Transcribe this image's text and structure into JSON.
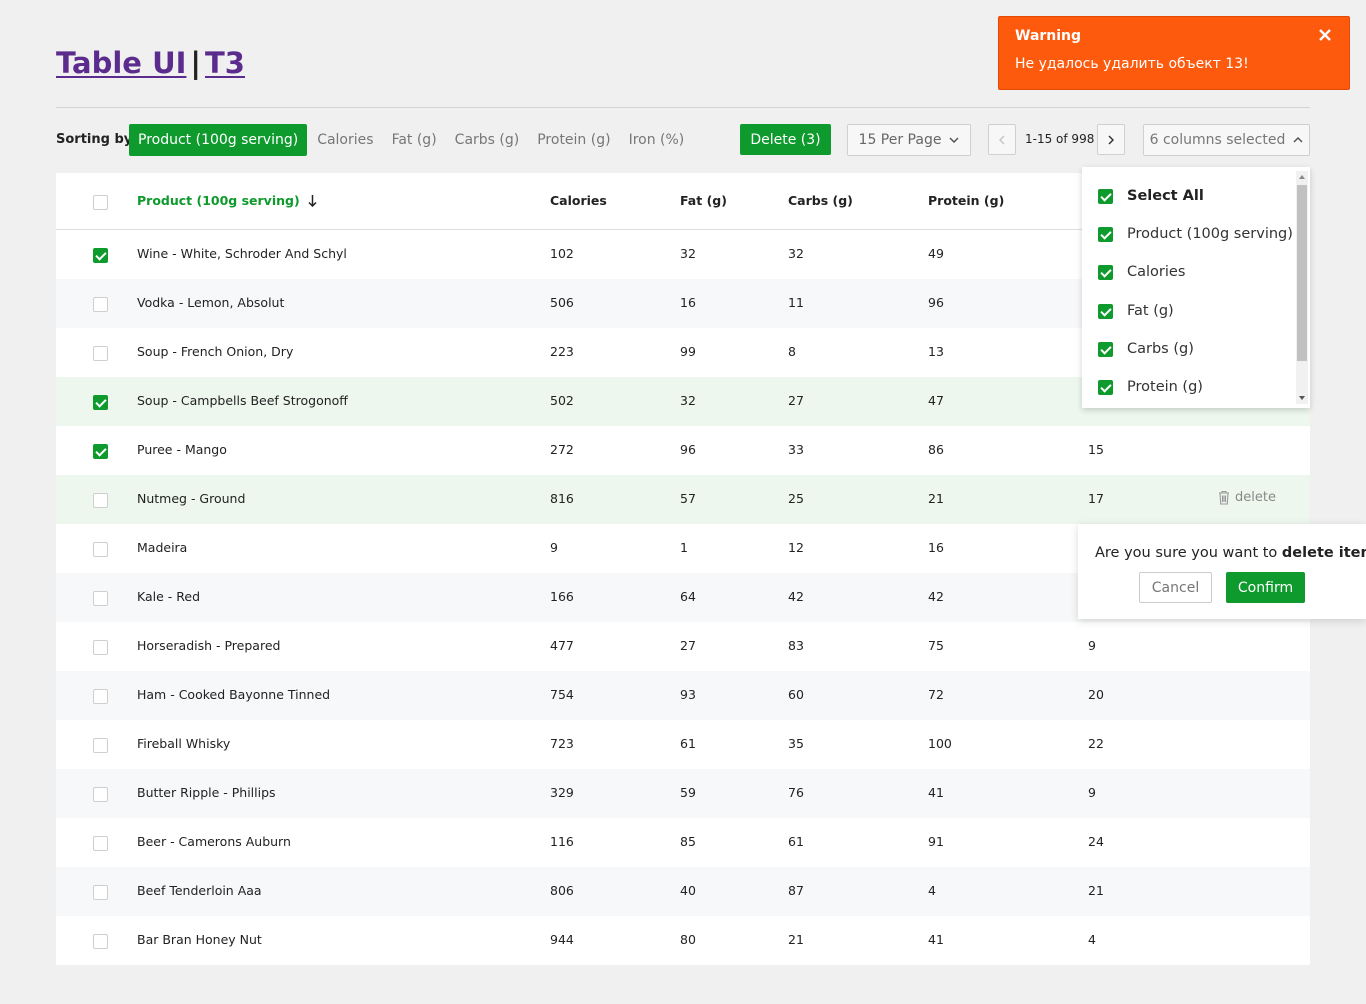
{
  "header": {
    "title_part1": "Table UI",
    "separator": "|",
    "title_part2": "T3"
  },
  "toolbar": {
    "sort_label": "Sorting by:",
    "sort_options": [
      "Product (100g serving)",
      "Calories",
      "Fat (g)",
      "Carbs (g)",
      "Protein (g)",
      "Iron (%)"
    ],
    "active_sort": "Product (100g serving)",
    "delete_label": "Delete (3)",
    "per_page_label": "15 Per Page",
    "pagination": "1-15 of 998",
    "columns_label": "6 columns selected"
  },
  "table": {
    "headers": [
      "Product (100g serving)",
      "Calories",
      "Fat (g)",
      "Carbs (g)",
      "Protein (g)"
    ],
    "rows": [
      {
        "checked": true,
        "highlight": false,
        "product": "Wine - White, Schroder And Schyl",
        "calories": "102",
        "fat": "32",
        "carbs": "32",
        "protein": "49",
        "iron": ""
      },
      {
        "checked": false,
        "highlight": false,
        "product": "Vodka - Lemon, Absolut",
        "calories": "506",
        "fat": "16",
        "carbs": "11",
        "protein": "96",
        "iron": ""
      },
      {
        "checked": false,
        "highlight": false,
        "product": "Soup - French Onion, Dry",
        "calories": "223",
        "fat": "99",
        "carbs": "8",
        "protein": "13",
        "iron": ""
      },
      {
        "checked": true,
        "highlight": true,
        "product": "Soup - Campbells Beef Strogonoff",
        "calories": "502",
        "fat": "32",
        "carbs": "27",
        "protein": "47",
        "iron": ""
      },
      {
        "checked": true,
        "highlight": false,
        "product": "Puree - Mango",
        "calories": "272",
        "fat": "96",
        "carbs": "33",
        "protein": "86",
        "iron": "15"
      },
      {
        "checked": false,
        "highlight": true,
        "product": "Nutmeg - Ground",
        "calories": "816",
        "fat": "57",
        "carbs": "25",
        "protein": "21",
        "iron": "17",
        "show_delete": true
      },
      {
        "checked": false,
        "highlight": false,
        "product": "Madeira",
        "calories": "9",
        "fat": "1",
        "carbs": "12",
        "protein": "16",
        "iron": ""
      },
      {
        "checked": false,
        "highlight": false,
        "product": "Kale - Red",
        "calories": "166",
        "fat": "64",
        "carbs": "42",
        "protein": "42",
        "iron": ""
      },
      {
        "checked": false,
        "highlight": false,
        "product": "Horseradish - Prepared",
        "calories": "477",
        "fat": "27",
        "carbs": "83",
        "protein": "75",
        "iron": "9"
      },
      {
        "checked": false,
        "highlight": false,
        "product": "Ham - Cooked Bayonne Tinned",
        "calories": "754",
        "fat": "93",
        "carbs": "60",
        "protein": "72",
        "iron": "20"
      },
      {
        "checked": false,
        "highlight": false,
        "product": "Fireball Whisky",
        "calories": "723",
        "fat": "61",
        "carbs": "35",
        "protein": "100",
        "iron": "22"
      },
      {
        "checked": false,
        "highlight": false,
        "product": "Butter Ripple - Phillips",
        "calories": "329",
        "fat": "59",
        "carbs": "76",
        "protein": "41",
        "iron": "9"
      },
      {
        "checked": false,
        "highlight": false,
        "product": "Beer - Camerons Auburn",
        "calories": "116",
        "fat": "85",
        "carbs": "61",
        "protein": "91",
        "iron": "24"
      },
      {
        "checked": false,
        "highlight": false,
        "product": "Beef Tenderloin Aaa",
        "calories": "806",
        "fat": "40",
        "carbs": "87",
        "protein": "4",
        "iron": "21"
      },
      {
        "checked": false,
        "highlight": false,
        "product": "Bar Bran Honey Nut",
        "calories": "944",
        "fat": "80",
        "carbs": "21",
        "protein": "41",
        "iron": "4"
      }
    ],
    "row_delete_label": "delete"
  },
  "columns_dropdown": {
    "items": [
      "Select All",
      "Product (100g serving)",
      "Calories",
      "Fat (g)",
      "Carbs (g)",
      "Protein (g)"
    ]
  },
  "confirm": {
    "text_prefix": "Are you sure you want to ",
    "text_bold": "delete item",
    "text_suffix": "?",
    "cancel_label": "Cancel",
    "confirm_label": "Confirm"
  },
  "toast": {
    "title": "Warning",
    "message": "Не удалось удалить объект 13!"
  },
  "colors": {
    "accent": "#0e9a2c",
    "title": "#5b2c8e",
    "warning": "#fd5a0e"
  },
  "icons": [
    "sort-down-arrow-icon",
    "chevron-down-icon",
    "chevron-left-icon",
    "chevron-right-icon",
    "chevron-up-icon",
    "trash-icon",
    "close-icon"
  ]
}
